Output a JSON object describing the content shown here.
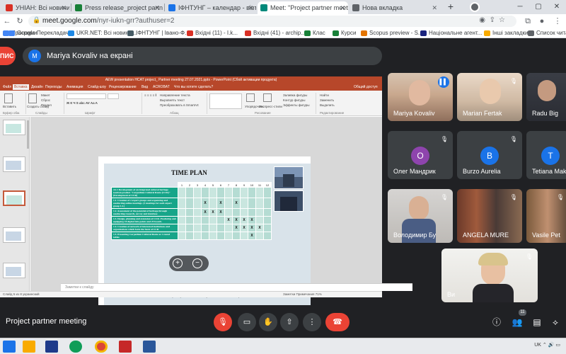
{
  "browser": {
    "tabs": [
      {
        "label": "УНІАН: Всі новини України, о",
        "color": "#d93025"
      },
      {
        "label": "Press release_project partner m",
        "color": "#188038"
      },
      {
        "label": "ІФНТУНГ – календар - вівторок",
        "color": "#1a73e8"
      },
      {
        "label": "Meet: \"Project partner meeti",
        "color": "#00897b"
      },
      {
        "label": "Нова вкладка",
        "color": "#5f6368"
      }
    ],
    "active_tab": 3,
    "new_tab": "+",
    "url_host": "meet.google.com",
    "url_path": "/nyr-iukn-grr?authuser=2",
    "bookmarks": [
      {
        "label": "Програми",
        "color": "#4285f4"
      },
      {
        "label": "Google Перекладач",
        "color": "#4285f4"
      },
      {
        "label": "UKR.NET: Всі новини...",
        "color": "#1e88e5"
      },
      {
        "label": "ІФНТУНГ | Івано-Ф...",
        "color": "#455a64"
      },
      {
        "label": "Вхідні (11) - I.k...",
        "color": "#d93025"
      },
      {
        "label": "Вхідні (41) - archip...",
        "color": "#d93025"
      },
      {
        "label": "Клас",
        "color": "#188038"
      },
      {
        "label": "Курси",
        "color": "#188038"
      },
      {
        "label": "Scopus preview - S...",
        "color": "#e37400"
      },
      {
        "label": "Національне агент...",
        "color": "#1a237e"
      },
      {
        "label": "Інші закладки",
        "color": "#f9ab00"
      },
      {
        "label": "Список читання",
        "color": "#5f6368"
      }
    ]
  },
  "meet": {
    "rec_label": "ПИС",
    "presenter_initial": "M",
    "presenter_label": "Mariya Kovaliv на екрані",
    "meeting_title": "Project partner meeting",
    "people_count": "11",
    "participants": [
      {
        "name": "Mariya Kovaliv",
        "type": "video",
        "speaking": true
      },
      {
        "name": "Marian Fertak",
        "type": "video",
        "muted": true
      },
      {
        "name": "Radu Big",
        "type": "video"
      },
      {
        "name": "Олег Мандрик",
        "type": "avatar",
        "initial": "О",
        "color": "#8e44ad",
        "muted": true
      },
      {
        "name": "Burzo Aurelia",
        "type": "avatar",
        "initial": "B",
        "color": "#1a73e8",
        "muted": true
      },
      {
        "name": "Tetiana Mak",
        "type": "avatar",
        "initial": "T",
        "color": "#1a73e8"
      },
      {
        "name": "Володимир Бу",
        "type": "video",
        "muted": true
      },
      {
        "name": "ANGELA MURE",
        "type": "video",
        "muted": true
      },
      {
        "name": "Vasile Pet",
        "type": "video",
        "muted": true
      },
      {
        "name": "Ви",
        "type": "video",
        "muted": true
      }
    ]
  },
  "ppt": {
    "window_title": "AEW presentation HCAT project_ Partner meeting 27.07.2021.pptx - PowerPoint (Сбой активации продукта)",
    "tabs": [
      "Файл",
      "Вставка",
      "Дизайн",
      "Переходы",
      "Анимация",
      "Слайд-шоу",
      "Рецензирование",
      "Вид",
      "ACROBAT",
      "Что вы хотите сделать?"
    ],
    "share_label": "Общий доступ",
    "ribbon_groups": [
      "Буфер обм.",
      "Слайды",
      "Шрифт",
      "Абзац",
      "Рисование",
      "Редактирование"
    ],
    "ribbon_items": [
      "Макет",
      "Сброс",
      "Раздел",
      "Создать слайд",
      "Вставить",
      "Направление текста",
      "Выровнять текст",
      "Преобразовать в SmartArt",
      "Упорядочить",
      "Экспресс-стили",
      "Заливка фигуры",
      "Контур фигуры",
      "Эффекты фигуры",
      "Найти",
      "Заменить",
      "Выделить"
    ],
    "notes_placeholder": "Заметки к слайду",
    "status_left": "Слайд 5 из 8   украинский",
    "status_right": "Заметки   Примечания   71%"
  },
  "slide": {
    "title": "TIME PLAN",
    "months": [
      "1",
      "2",
      "3",
      "4",
      "5",
      "6",
      "7",
      "8",
      "9",
      "10",
      "11",
      "12"
    ],
    "activities": [
      {
        "text": "A1.1 Development of an integrated cultural heritage tourism product \"Carpathian Cultural Route (CCR)\" (Development of CCR)",
        "marks": [
          "",
          "",
          "",
          "",
          "",
          "",
          "",
          "",
          "",
          "",
          "",
          ""
        ]
      },
      {
        "text": "1.1. Creation of 2 expert groups and organizing and conducting online meetings. (2 meetings for each expert group 1.2.)",
        "marks": [
          "",
          "",
          "",
          "X",
          "",
          "X",
          "",
          "X",
          "",
          "",
          "",
          ""
        ]
      },
      {
        "text": "1.2. Assessment of the potential of heritage through conducting research, survey and database",
        "marks": [
          "",
          "",
          "",
          "X",
          "X",
          "X",
          "",
          "",
          "",
          "",
          "",
          ""
        ]
      },
      {
        "text": "1.3. Design, planning and extension of CCR. Producing and equipping 10 digital info points and 25 boards",
        "marks": [
          "",
          "",
          "",
          "",
          "",
          "",
          "X",
          "X",
          "X",
          "X",
          "",
          ""
        ]
      },
      {
        "text": "1.4. Creation of network of interested institutions and organizations which form the basis of CCR",
        "marks": [
          "",
          "",
          "",
          "",
          "",
          "",
          "",
          "X",
          "X",
          "X",
          "X",
          ""
        ]
      },
      {
        "text": "1.5. Presenting Carpathian Cultural Route at 1 round tables",
        "marks": [
          "",
          "",
          "",
          "",
          "",
          "",
          "",
          "",
          "",
          "X",
          "",
          ""
        ]
      }
    ],
    "footer": "This publication was produced with the financial support of the European Union. Its contents are the sole responsibility of the public organization \"Association of Ivano-Frankivsk (AEDIF)\" and do not necessarily reflect the views of the European Union."
  },
  "taskbar": {
    "tray": "UK  ⌃  🔊  ▭"
  }
}
